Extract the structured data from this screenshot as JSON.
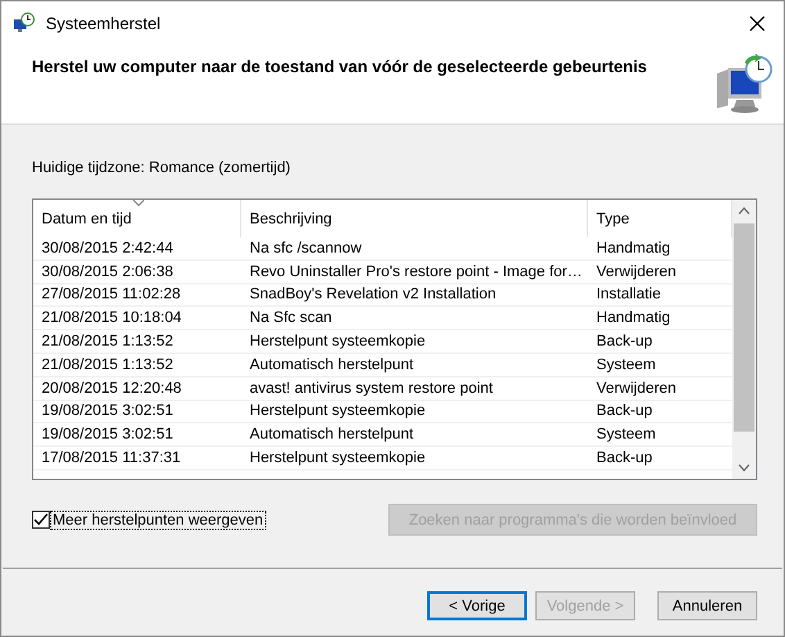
{
  "window": {
    "title": "Systeemherstel"
  },
  "heading": "Herstel uw computer naar de toestand van vóór de geselecteerde gebeurtenis",
  "timezone_label": "Huidige tijdzone: Romance (zomertijd)",
  "table": {
    "columns": [
      {
        "label": "Datum en tijd",
        "sorted": true
      },
      {
        "label": "Beschrijving",
        "sorted": false
      },
      {
        "label": "Type",
        "sorted": false
      }
    ],
    "rows": [
      {
        "date": "30/08/2015 2:42:44",
        "description": "Na sfc /scannow",
        "type": "Handmatig",
        "selected": false
      },
      {
        "date": "30/08/2015 2:06:38",
        "description": "Revo Uninstaller Pro's restore point - Image for…",
        "type": "Verwijderen",
        "selected": false
      },
      {
        "date": "27/08/2015 11:02:28",
        "description": "SnadBoy's Revelation v2 Installation",
        "type": "Installatie",
        "selected": false
      },
      {
        "date": "21/08/2015 10:18:04",
        "description": "Na Sfc scan",
        "type": "Handmatig",
        "selected": false
      },
      {
        "date": "21/08/2015 1:13:52",
        "description": "Herstelpunt systeemkopie",
        "type": "Back-up",
        "selected": false
      },
      {
        "date": "21/08/2015 1:13:52",
        "description": "Automatisch herstelpunt",
        "type": "Systeem",
        "selected": false
      },
      {
        "date": "20/08/2015 12:20:48",
        "description": "avast! antivirus system restore point",
        "type": "Verwijderen",
        "selected": false
      },
      {
        "date": "19/08/2015 3:02:51",
        "description": "Herstelpunt systeemkopie",
        "type": "Back-up",
        "selected": false
      },
      {
        "date": "19/08/2015 3:02:51",
        "description": "Automatisch herstelpunt",
        "type": "Systeem",
        "selected": false
      },
      {
        "date": "17/08/2015 11:37:31",
        "description": "Herstelpunt systeemkopie",
        "type": "Back-up",
        "selected": false
      }
    ]
  },
  "show_more": {
    "label": "Meer herstelpunten weergeven",
    "checked": true
  },
  "scan_button": {
    "label": "Zoeken naar programma's die worden beïnvloed",
    "disabled": true
  },
  "buttons": [
    {
      "label": "< Vorige",
      "disabled": false,
      "default": true
    },
    {
      "label": "Volgende >",
      "disabled": true,
      "default": false
    },
    {
      "label": "Annuleren",
      "disabled": false,
      "default": false
    }
  ]
}
